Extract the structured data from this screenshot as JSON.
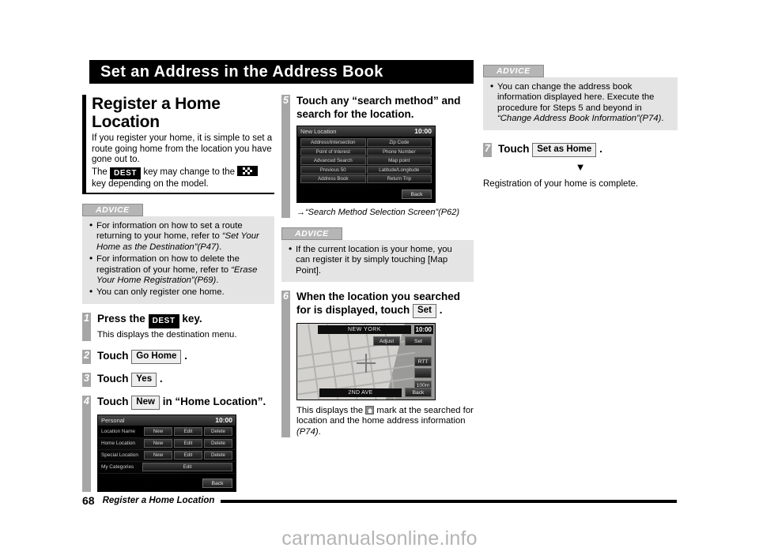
{
  "page_title": "Set an Address in the Address Book",
  "left": {
    "section_heading": "Register a Home Location",
    "intro": {
      "line1": "If you register your home, it is simple to set a route going home from the location you have gone out to.",
      "the_word": "The",
      "dest_key": "DEST",
      "mid_text": "key may change to the",
      "flag_key_name": "checkered-flag-key",
      "tail_text": "key depending on the model."
    },
    "advice": {
      "tab": "ADVICE",
      "items": [
        {
          "plain1": "For information on how to set a route returning to your home, refer to ",
          "italic": "“Set Your Home as the Destination”(P47)",
          "plain2": "."
        },
        {
          "plain1": "For information on how to delete the registration of your home, refer to ",
          "italic": "“Erase Your Home Registration”(P69)",
          "plain2": "."
        },
        {
          "plain1": "You can only register one home.",
          "italic": "",
          "plain2": ""
        }
      ]
    },
    "steps": [
      {
        "num": "1",
        "pre": "Press the",
        "chip": "DEST",
        "post": "key.",
        "sub": "This displays the destination menu."
      },
      {
        "num": "2",
        "pre": "Touch",
        "chip": "Go Home",
        "post": ".",
        "sub": ""
      },
      {
        "num": "3",
        "pre": "Touch",
        "chip": "Yes",
        "post": ".",
        "sub": ""
      },
      {
        "num": "4",
        "pre": "Touch",
        "chip": "New",
        "post": "in “Home Location”.",
        "sub": ""
      }
    ],
    "screenshot": {
      "name": "personal-screen",
      "header_title": "Personal",
      "clock": "10:00",
      "rows": [
        {
          "label": "Location Name",
          "buttons": [
            "New",
            "Edit",
            "Delete"
          ]
        },
        {
          "label": "Home Location",
          "buttons": [
            "New",
            "Edit",
            "Delete"
          ]
        },
        {
          "label": "Special Location",
          "buttons": [
            "New",
            "Edit",
            "Delete"
          ]
        },
        {
          "label": "My Categories",
          "buttons": [
            "Edit"
          ]
        }
      ],
      "back": "Back"
    }
  },
  "middle": {
    "step5": {
      "num": "5",
      "title": "Touch any “search method” and search for the location."
    },
    "screenshot": {
      "name": "new-location-screen",
      "header_title": "New Location",
      "clock": "10:00",
      "buttons": [
        "Address/Intersection",
        "Zip Code",
        "Point of Interest",
        "Phone Number",
        "Advanced Search",
        "Map point",
        "Previous 50",
        "Latitude/Longitude",
        "Address Book",
        "Return Trip"
      ],
      "back": "Back"
    },
    "reference": "→“Search Method Selection Screen”(P62)",
    "advice": {
      "tab": "ADVICE",
      "items": [
        {
          "plain1": "If the current location is your home, you can register it by simply touching [Map Point].",
          "italic": "",
          "plain2": ""
        }
      ]
    },
    "step6": {
      "num": "6",
      "pre": "When the location you searched for is displayed, touch",
      "chip": "Set",
      "post": "."
    },
    "map_screenshot": {
      "name": "map-set-screen",
      "city": "NEW YORK",
      "clock": "10:00",
      "adjust": "Adjust",
      "set": "Set",
      "rtt": "RTT",
      "scale": "100m",
      "street": "2ND AVE",
      "back": "Back"
    },
    "result": {
      "pre": "This displays the",
      "icon_name": "home-mark-icon",
      "mid": "mark at the searched for location and the home address information",
      "italic": "(P74)",
      "post": "."
    }
  },
  "right": {
    "advice": {
      "tab": "ADVICE",
      "items": [
        {
          "plain1": "You can change the address book information displayed here. Execute the procedure for Steps 5 and beyond in ",
          "italic": "“Change Address Book Information”(P74)",
          "plain2": "."
        }
      ]
    },
    "step7": {
      "num": "7",
      "pre": "Touch",
      "chip": "Set as Home",
      "post": "."
    },
    "arrow": "▼",
    "completion": "Registration of your home is complete."
  },
  "footer": {
    "page_number": "68",
    "title": "Register a Home Location"
  },
  "watermark": "carmanualsonline.info"
}
